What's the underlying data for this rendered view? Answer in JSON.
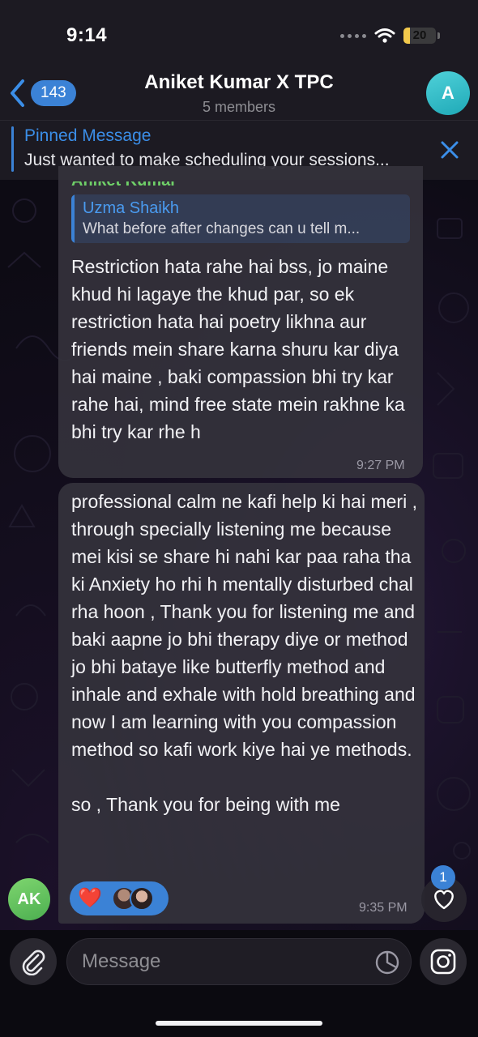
{
  "status_bar": {
    "time": "9:14",
    "battery": "20",
    "battery_level": 0.2
  },
  "header": {
    "back_count": "143",
    "title": "Aniket Kumar X TPC",
    "subtitle": "5 members",
    "avatar_letter": "A"
  },
  "pinned": {
    "title": "Pinned Message",
    "text": "Just wanted to make scheduling your sessions..."
  },
  "messages": [
    {
      "sender": "Aniket Kumar",
      "reply": {
        "name": "Uzma Shaikh",
        "text": "What before after changes can u tell m..."
      },
      "text": "Restriction hata rahe hai bss, jo maine khud hi lagaye the khud par, so ek restriction hata hai poetry likhna aur friends mein share karna shuru kar diya hai maine , baki compassion bhi try kar rahe hai, mind free state mein rakhne ka bhi try kar rhe h",
      "time": "9:27 PM"
    },
    {
      "text": "professional calm ne kafi help ki hai meri , through specially listening me because mei kisi se share hi nahi kar paa raha tha ki Anxiety ho rhi h mentally disturbed chal rha hoon , Thank you for listening me and baki aapne jo bhi therapy diye or method jo bhi bataye like butterfly method and inhale and exhale with hold breathing and now I am learning with you compassion method so kafi work kiye hai ye methods.\n\nso , Thank you for being with me",
      "time": "9:35 PM",
      "sender_avatar": "AK",
      "reaction": "❤️"
    }
  ],
  "reaction_badge": "1",
  "input": {
    "placeholder": "Message"
  },
  "icons": [
    "back-chevron-icon",
    "close-icon",
    "paperclip-icon",
    "sticker-icon",
    "instagram-icon",
    "heart-icon",
    "wifi-icon"
  ]
}
